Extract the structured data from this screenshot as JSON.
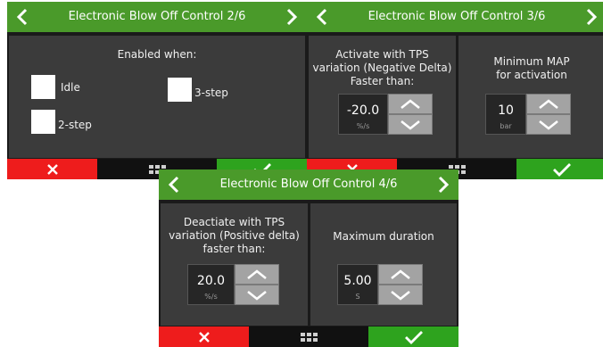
{
  "screens": [
    {
      "title": "Electronic Blow Off Control 2/6",
      "enabled_when": "Enabled when:",
      "options": [
        "Idle",
        "3-step",
        "2-step"
      ]
    },
    {
      "title": "Electronic Blow Off Control 3/6",
      "left": {
        "label_lines": [
          "Activate with TPS",
          "variation (Negative Delta)",
          "Faster than:"
        ],
        "value": "-20.0",
        "unit": "%/s"
      },
      "right": {
        "label_lines": [
          "Minimum MAP",
          "for activation"
        ],
        "value": "10",
        "unit": "bar"
      }
    },
    {
      "title": "Electronic Blow Off Control 4/6",
      "left": {
        "label_lines": [
          "Deactiate with TPS",
          "variation (Positive delta)",
          "faster than:"
        ],
        "value": "20.0",
        "unit": "%/s"
      },
      "right": {
        "label_lines": [
          "Maximum duration"
        ],
        "value": "5.00",
        "unit": "S"
      }
    }
  ],
  "colors": {
    "header": "#4a9a2a",
    "cancel": "#ee1c1c",
    "confirm": "#2ea31e",
    "panel": "#3b3b3b",
    "stepper": "#a3a3a3"
  },
  "icons": {
    "prev": "chevron-left-icon",
    "next": "chevron-right-icon",
    "cancel": "x-icon",
    "menu": "grid-icon",
    "confirm": "check-icon",
    "up": "chevron-up-icon",
    "down": "chevron-down-icon"
  }
}
